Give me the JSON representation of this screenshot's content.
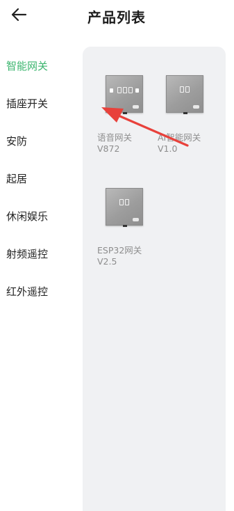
{
  "header": {
    "title": "产品列表",
    "back_icon": "arrow-left-icon"
  },
  "sidebar": {
    "items": [
      {
        "label": "智能网关",
        "active": true
      },
      {
        "label": "插座开关",
        "active": false
      },
      {
        "label": "安防",
        "active": false
      },
      {
        "label": "起居",
        "active": false
      },
      {
        "label": "休闲娱乐",
        "active": false
      },
      {
        "label": "射频遥控",
        "active": false
      },
      {
        "label": "红外遥控",
        "active": false
      }
    ]
  },
  "products": [
    {
      "name": "语音网关",
      "version": "V872"
    },
    {
      "name": "AI智能网关",
      "version": "V1.0"
    },
    {
      "name": "ESP32网关",
      "version": "V2.5"
    }
  ],
  "colors": {
    "accent": "#3bb56e",
    "annotation": "#e8413b",
    "panel_bg": "#f0f1f3"
  }
}
